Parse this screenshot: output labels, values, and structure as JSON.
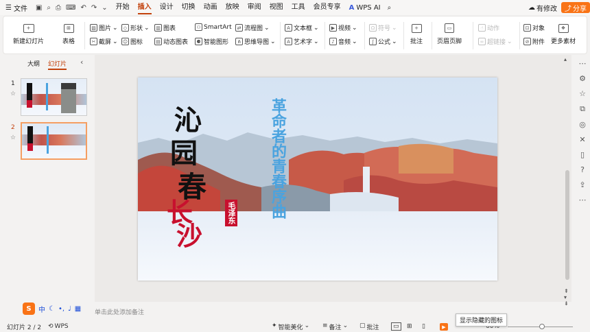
{
  "menubar": {
    "file_label": "文件",
    "tabs": [
      "开始",
      "插入",
      "设计",
      "切换",
      "动画",
      "放映",
      "审阅",
      "视图",
      "工具",
      "会员专享"
    ],
    "active_tab": "插入",
    "wps_ai": "WPS AI",
    "changes": "有修改",
    "share": "分享"
  },
  "ribbon": {
    "new_slide": "新建幻灯片",
    "table": "表格",
    "picture": "图片",
    "screenshot": "截屏",
    "shape": "形状",
    "icon": "图标",
    "chart": "图表",
    "dynamic_chart": "动态图表",
    "smartart": "SmartArt",
    "smart_graphic": "智能图形",
    "flowchart": "流程图",
    "mindmap": "思维导图",
    "textbox": "文本框",
    "wordart": "艺术字",
    "video": "视频",
    "audio": "音频",
    "symbol": "符号",
    "formula": "公式",
    "comment": "批注",
    "header_footer": "页眉页脚",
    "action": "动作",
    "hyperlink": "超链接",
    "object": "对象",
    "attachment": "附件",
    "more_material": "更多素材"
  },
  "pane": {
    "tab_outline": "大纲",
    "tab_slides": "幻灯片",
    "slides": [
      {
        "num": "1"
      },
      {
        "num": "2"
      }
    ]
  },
  "slide": {
    "title_chars": [
      "沁",
      "园",
      "春"
    ],
    "subtitle_chars": [
      "长",
      "沙"
    ],
    "seal": "毛泽东",
    "vertical_text": "革命者的青春序曲"
  },
  "notes_placeholder": "单击此处添加备注",
  "ime": {
    "label": "中"
  },
  "status": {
    "slide_info": "幻灯片 2 / 2",
    "wps": "WPS",
    "beautify": "智能美化",
    "notes": "备注",
    "comment": "批注",
    "zoom": "60%"
  },
  "tooltip": "显示隐藏的图标",
  "colors": {
    "accent": "#c2410c",
    "share": "#f97316",
    "title_red": "#c8102e",
    "vertical_blue": "#4aa3df"
  }
}
